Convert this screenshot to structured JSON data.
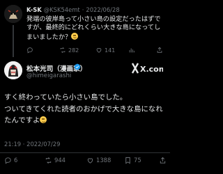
{
  "reply": {
    "display_name": "K-SK",
    "handle": "@KSK54emt",
    "separator": "·",
    "date": "2022/06/28",
    "text": "発端の彼岸島って小さい島の設定だったはずですが、最終的にどれくらい大きな島になってしまいましたか？",
    "replies": "",
    "retweets": "282",
    "likes": "141"
  },
  "tweet": {
    "display_name": "松本光司（漫画家）",
    "handle": "@himeigarashi",
    "brand": "X.com",
    "line1": "すく終わっていたら小さい島でした。",
    "line2": "ついてきてくれた読者のおかげで大きな島になれたんですよ",
    "timestamp": "21:19 · 2022/07/29",
    "replies": "6",
    "retweets": "944",
    "likes": "1388",
    "bookmarks": "75"
  },
  "colors": {
    "background": "#000000",
    "text": "#e7e9ea",
    "muted": "#71767b",
    "verified": "#1d9bf0",
    "divider": "#2f3336"
  },
  "icons": [
    "reply-icon",
    "retweet-icon",
    "like-icon",
    "views-icon",
    "share-icon",
    "bookmark-icon",
    "verified-badge-icon",
    "x-logo"
  ]
}
